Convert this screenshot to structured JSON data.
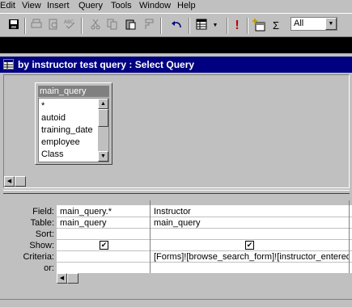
{
  "menu": [
    "Edit",
    "View",
    "Insert",
    "Query",
    "Tools",
    "Window",
    "Help"
  ],
  "toolbar": {
    "icons": [
      "save-icon",
      "print-icon",
      "print-preview-icon",
      "spelling-icon",
      "cut-icon",
      "copy-icon",
      "paste-icon",
      "format-painter-icon",
      "undo-icon",
      "query-type-icon",
      "run-icon",
      "show-table-icon",
      "totals-icon"
    ],
    "run_glyph": "!",
    "totals_glyph": "Σ",
    "top_values": "All"
  },
  "window": {
    "title": "by instructor test query : Select Query"
  },
  "table": {
    "name": "main_query",
    "fields": [
      "*",
      "autoid",
      "training_date",
      "employee",
      "Class"
    ]
  },
  "grid": {
    "row_labels": [
      "Field:",
      "Table:",
      "Sort:",
      "Show:",
      "Criteria:",
      "or:"
    ],
    "columns": [
      {
        "field": "main_query.*",
        "table": "main_query",
        "sort": "",
        "show": true,
        "criteria": ""
      },
      {
        "field": "Instructor",
        "table": "main_query",
        "sort": "",
        "show": true,
        "criteria": "[Forms]![browse_search_form]![instructor_entered]"
      }
    ]
  }
}
